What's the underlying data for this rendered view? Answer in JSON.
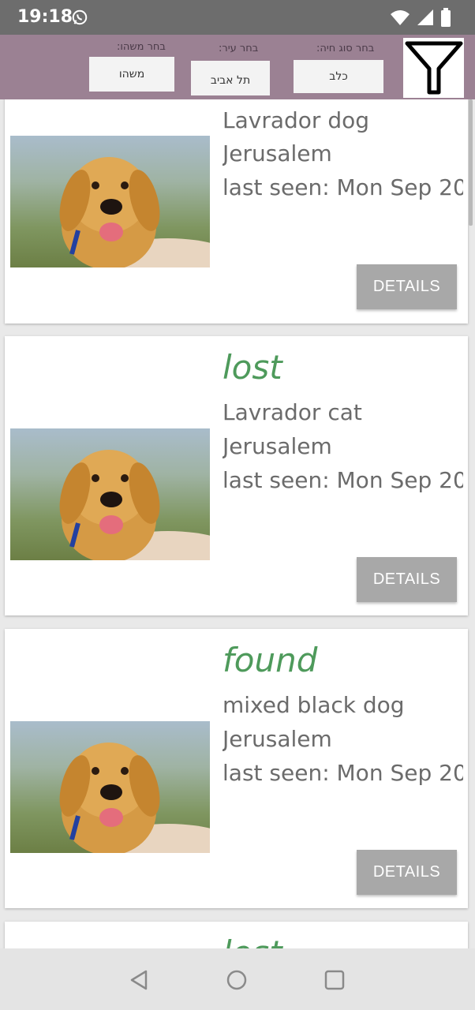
{
  "status_bar": {
    "time": "19:18",
    "icons": [
      "whatsapp-icon",
      "wifi-icon",
      "signal-icon",
      "battery-icon"
    ]
  },
  "filters": {
    "something": {
      "label": "בחר משהו:",
      "value": "משהו"
    },
    "city": {
      "label": "בחר עיר:",
      "value": "תל אביב"
    },
    "animal": {
      "label": "בחר סוג חיה:",
      "value": "כלב"
    },
    "filter_icon": "filter-funnel-icon"
  },
  "cards": [
    {
      "status": "",
      "breed_type": "Lavrador  dog",
      "city": "Jerusalem",
      "last_seen": "last seen:  Mon Sep 20",
      "details_label": "DETAILS"
    },
    {
      "status": "lost",
      "breed_type": "Lavrador  cat",
      "city": "Jerusalem",
      "last_seen": "last seen:  Mon Sep 20",
      "details_label": "DETAILS"
    },
    {
      "status": "found",
      "breed_type": "mixed black  dog",
      "city": "Jerusalem",
      "last_seen": "last seen:  Mon Sep 20",
      "details_label": "DETAILS"
    },
    {
      "status": "lost",
      "breed_type": "",
      "city": "",
      "last_seen": "",
      "details_label": ""
    }
  ],
  "colors": {
    "status_bar": "#6d6d6d",
    "filter_bar": "#9b8193",
    "status_text": "#4e9a5b",
    "details_button": "#a8a8a8"
  },
  "nav_bar": {
    "icons": [
      "back-icon",
      "home-icon",
      "recents-icon"
    ]
  }
}
